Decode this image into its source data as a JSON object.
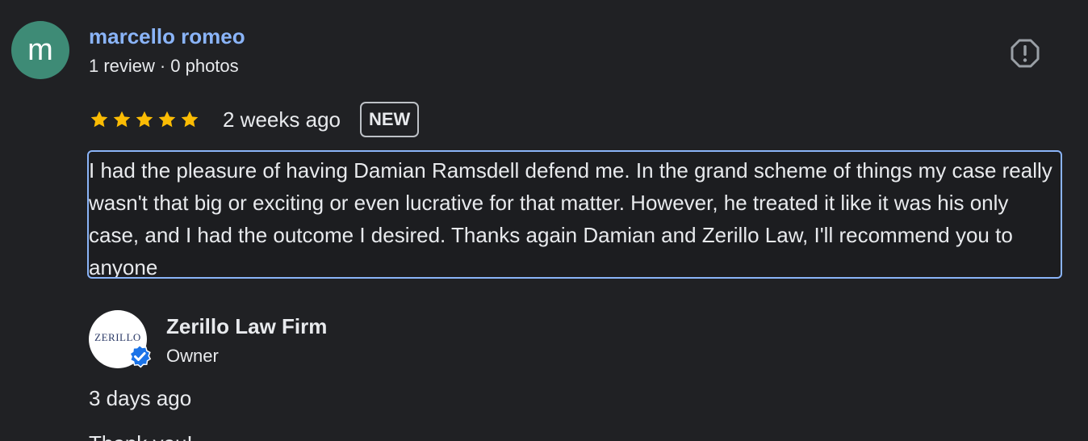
{
  "review": {
    "avatar_letter": "m",
    "avatar_color": "#3e8b76",
    "reviewer_name": "marcello romeo",
    "review_count": "1 review",
    "meta_separator": "·",
    "photo_count": "0 photos",
    "report_icon": "report-flag-icon",
    "rating": 5,
    "rating_max": 5,
    "date": "2 weeks ago",
    "badge": "NEW",
    "text": "I had the pleasure of having Damian Ramsdell defend me. In the grand scheme of things my case really wasn't that big or exciting or even lucrative for that matter. However, he treated it like it was his only case, and I had the outcome I desired. Thanks again Damian and Zerillo Law, I'll recommend you to anyone"
  },
  "owner_response": {
    "logo_text": "ZERILLO",
    "verified_icon": "verified-check-icon",
    "name": "Zerillo Law Firm",
    "role": "Owner",
    "date": "3 days ago",
    "reply_partial": "Thank you!"
  },
  "colors": {
    "background": "#202124",
    "link": "#8ab4f8",
    "star": "#fbbc04",
    "verified": "#1a73e8"
  }
}
